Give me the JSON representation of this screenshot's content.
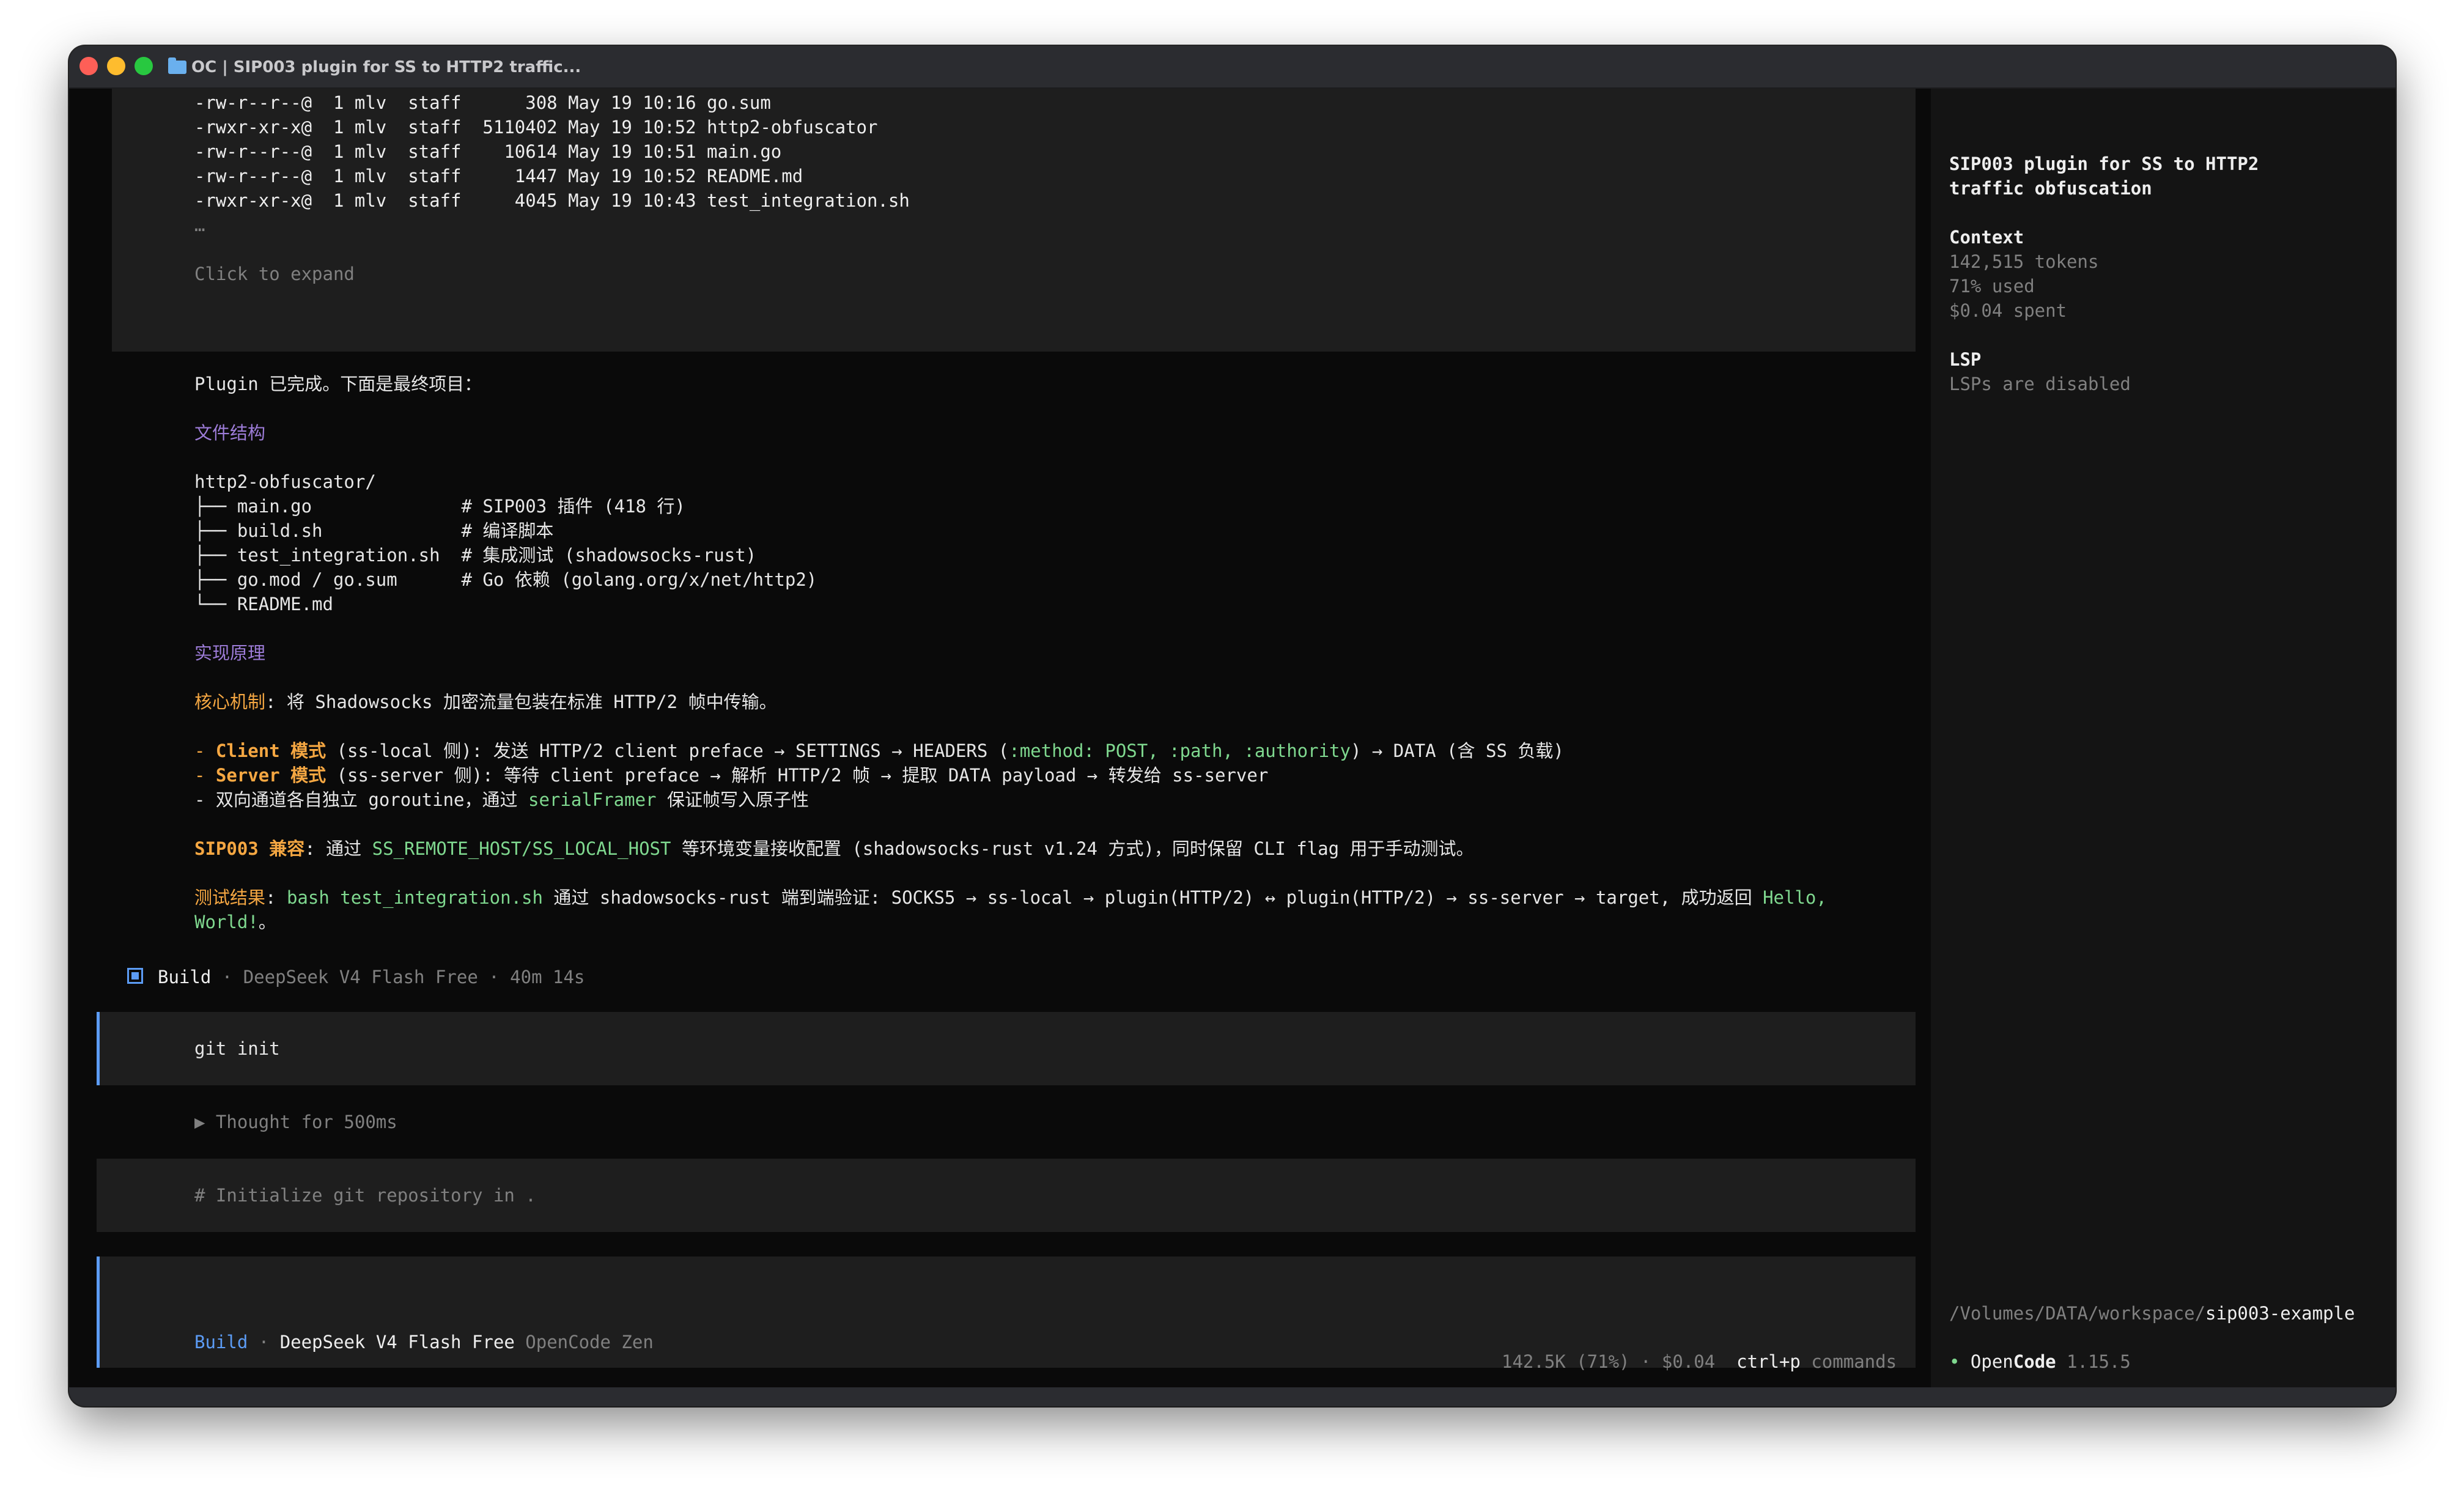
{
  "window": {
    "title": "OC | SIP003 plugin for SS to HTTP2 traffic..."
  },
  "listing": {
    "rows": [
      "-rw-r--r--@  1 mlv  staff      308 May 19 10:16 go.sum",
      "-rwxr-xr-x@  1 mlv  staff  5110402 May 19 10:52 http2-obfuscator",
      "-rw-r--r--@  1 mlv  staff    10614 May 19 10:51 main.go",
      "-rw-r--r--@  1 mlv  staff     1447 May 19 10:52 README.md",
      "-rwxr-xr-x@  1 mlv  staff     4045 May 19 10:43 test_integration.sh"
    ],
    "ellipsis": "…",
    "expand_label": "Click to expand"
  },
  "message": {
    "intro": "Plugin 已完成。下面是最终项目：",
    "section_files": "文件结构",
    "tree": [
      "http2-obfuscator/",
      "├── main.go              # SIP003 插件 (418 行)",
      "├── build.sh             # 编译脚本",
      "├── test_integration.sh  # 集成测试 (shadowsocks-rust)",
      "├── go.mod / go.sum      # Go 依赖 (golang.org/x/net/http2)",
      "└── README.md"
    ],
    "section_impl": "实现原理",
    "core_label": "核心机制",
    "core_text": ": 将 Shadowsocks 加密流量包装在标准 HTTP/2 帧中传输。",
    "client_dash": "- ",
    "client_label": "Client 模式",
    "client_text_1": " (ss-local 侧): 发送 HTTP/2 client preface → SETTINGS → HEADERS (",
    "client_code": ":method: POST, :path, :authority",
    "client_text_2": ") → DATA (含 SS 负载)",
    "server_dash": "- ",
    "server_label": "Server 模式",
    "server_text": " (ss-server 侧): 等待 client preface → 解析 HTTP/2 帧 → 提取 DATA payload → 转发给 ss-server",
    "bidir_text_1": "- 双向通道各自独立 goroutine，通过 ",
    "bidir_code": "serialFramer",
    "bidir_text_2": " 保证帧写入原子性",
    "sip_label": "SIP003 兼容",
    "sip_text_1": ": 通过 ",
    "sip_code": "SS_REMOTE_HOST/SS_LOCAL_HOST",
    "sip_text_2": " 等环境变量接收配置 (shadowsocks-rust v1.24 方式)，同时保留 CLI flag 用于手动测试。",
    "test_label": "测试结果",
    "test_sep": ": ",
    "test_code": "bash test_integration.sh",
    "test_text": " 通过 shadowsocks-rust 端到端验证: SOCKS5 → ss-local → plugin(HTTP/2) ↔ plugin(HTTP/2) → ss-server → target, 成功返回 ",
    "test_code_2a": "Hello,",
    "test_code_2b": "World!",
    "test_end": "。"
  },
  "build_status": {
    "mode": "Build",
    "detail": " · DeepSeek V4 Flash Free · 40m 14s"
  },
  "user_command": "git init",
  "thought": "▶ Thought for 500ms",
  "comment": "# Initialize git repository in .",
  "prompt": {
    "mode": "Build",
    "sep": " · ",
    "model": "DeepSeek V4 Flash Free",
    "provider": " OpenCode Zen"
  },
  "footer": {
    "usage": "142.5K (71%) · $0.04",
    "shortcut": "ctrl+p",
    "shortcut_label": " commands"
  },
  "sidebar": {
    "title_line1": "SIP003 plugin for SS to HTTP2",
    "title_line2": "traffic obfuscation",
    "context_heading": "Context",
    "tokens": "142,515 tokens",
    "used": "71% used",
    "spent": "$0.04 spent",
    "lsp_heading": "LSP",
    "lsp_status": "LSPs are disabled",
    "path_prefix": "/Volumes/DATA/workspace/",
    "path_dir": "sip003-example",
    "version_dot": "•",
    "version_open": " Open",
    "version_code": "Code",
    "version_num": " 1.15.5"
  },
  "colors": {
    "accent_blue": "#5c9cf5",
    "accent_purple": "#9d7cd8",
    "accent_orange": "#f5a742",
    "accent_green": "#7fd88f",
    "background": "#0a0a0a"
  }
}
